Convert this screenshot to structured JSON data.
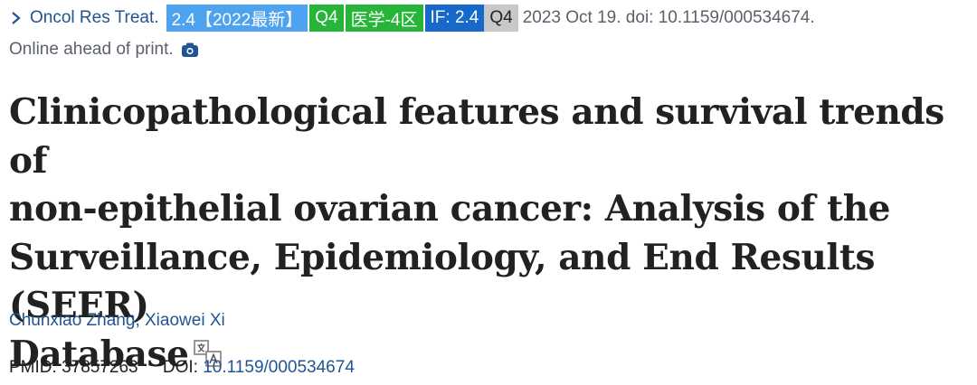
{
  "citation": {
    "journal": "Oncol Res Treat.",
    "badges": [
      {
        "text": "2.4【2022最新】",
        "color": "#4da3f0"
      },
      {
        "text": "Q4",
        "color": "#26b539"
      },
      {
        "text": "医学-4区",
        "color": "#26b539"
      },
      {
        "text": "IF: 2.4",
        "color": "#1769c9"
      },
      {
        "text": "Q4",
        "color": "#c8c8c8"
      }
    ],
    "date_doi": "2023 Oct 19. doi: 10.1159/000534674.",
    "status": "Online ahead of print."
  },
  "title": {
    "line1": "Clinicopathological features and survival trends of",
    "line2": "non-epithelial ovarian cancer: Analysis of the",
    "line3": "Surveillance, Epidemiology, and End Results (SEER)",
    "line4": "Database"
  },
  "authors": [
    "Chunxiao Zhang",
    "Xiaowei Xi"
  ],
  "author_separator": ", ",
  "ids": {
    "pmid_label": "PMID:",
    "pmid": "37857263",
    "doi_label": "DOI:",
    "doi": "10.1159/000534674"
  },
  "icons": {
    "journal_link": "chevron-right-icon",
    "status": "camera-icon",
    "title": "translate-icon"
  }
}
